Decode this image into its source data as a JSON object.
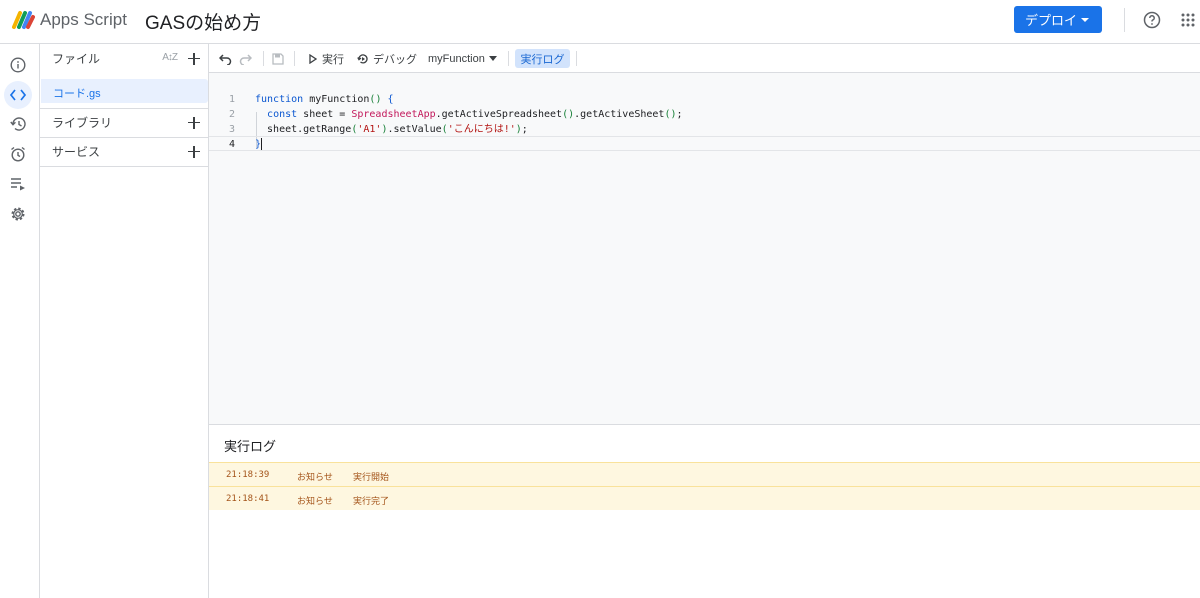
{
  "header": {
    "app_name": "Apps Script",
    "project_title": "GASの始め方",
    "deploy_label": "デプロイ",
    "accent_color": "#1a73e8"
  },
  "rail": {
    "icons": [
      "info-icon",
      "code-icon",
      "history-icon",
      "alarm-icon",
      "executions-icon",
      "settings-icon"
    ]
  },
  "files": {
    "header_label": "ファイル",
    "items": [
      {
        "label": "コード.gs"
      }
    ],
    "libraries_label": "ライブラリ",
    "services_label": "サービス"
  },
  "toolbar": {
    "run_label": "実行",
    "debug_label": "デバッグ",
    "function_select": "myFunction",
    "log_toggle_label": "実行ログ"
  },
  "editor": {
    "lines": [
      {
        "num": "1",
        "text": "function myFunction() {"
      },
      {
        "num": "2",
        "text": "  const sheet = SpreadsheetApp.getActiveSpreadsheet().getActiveSheet();"
      },
      {
        "num": "3",
        "text": "  sheet.getRange('A1').setValue('こんにちは!');"
      },
      {
        "num": "4",
        "text": "}"
      }
    ]
  },
  "log": {
    "title": "実行ログ",
    "rows": [
      {
        "time": "21:18:39",
        "level": "お知らせ",
        "message": "実行開始"
      },
      {
        "time": "21:18:41",
        "level": "お知らせ",
        "message": "実行完了"
      }
    ]
  }
}
